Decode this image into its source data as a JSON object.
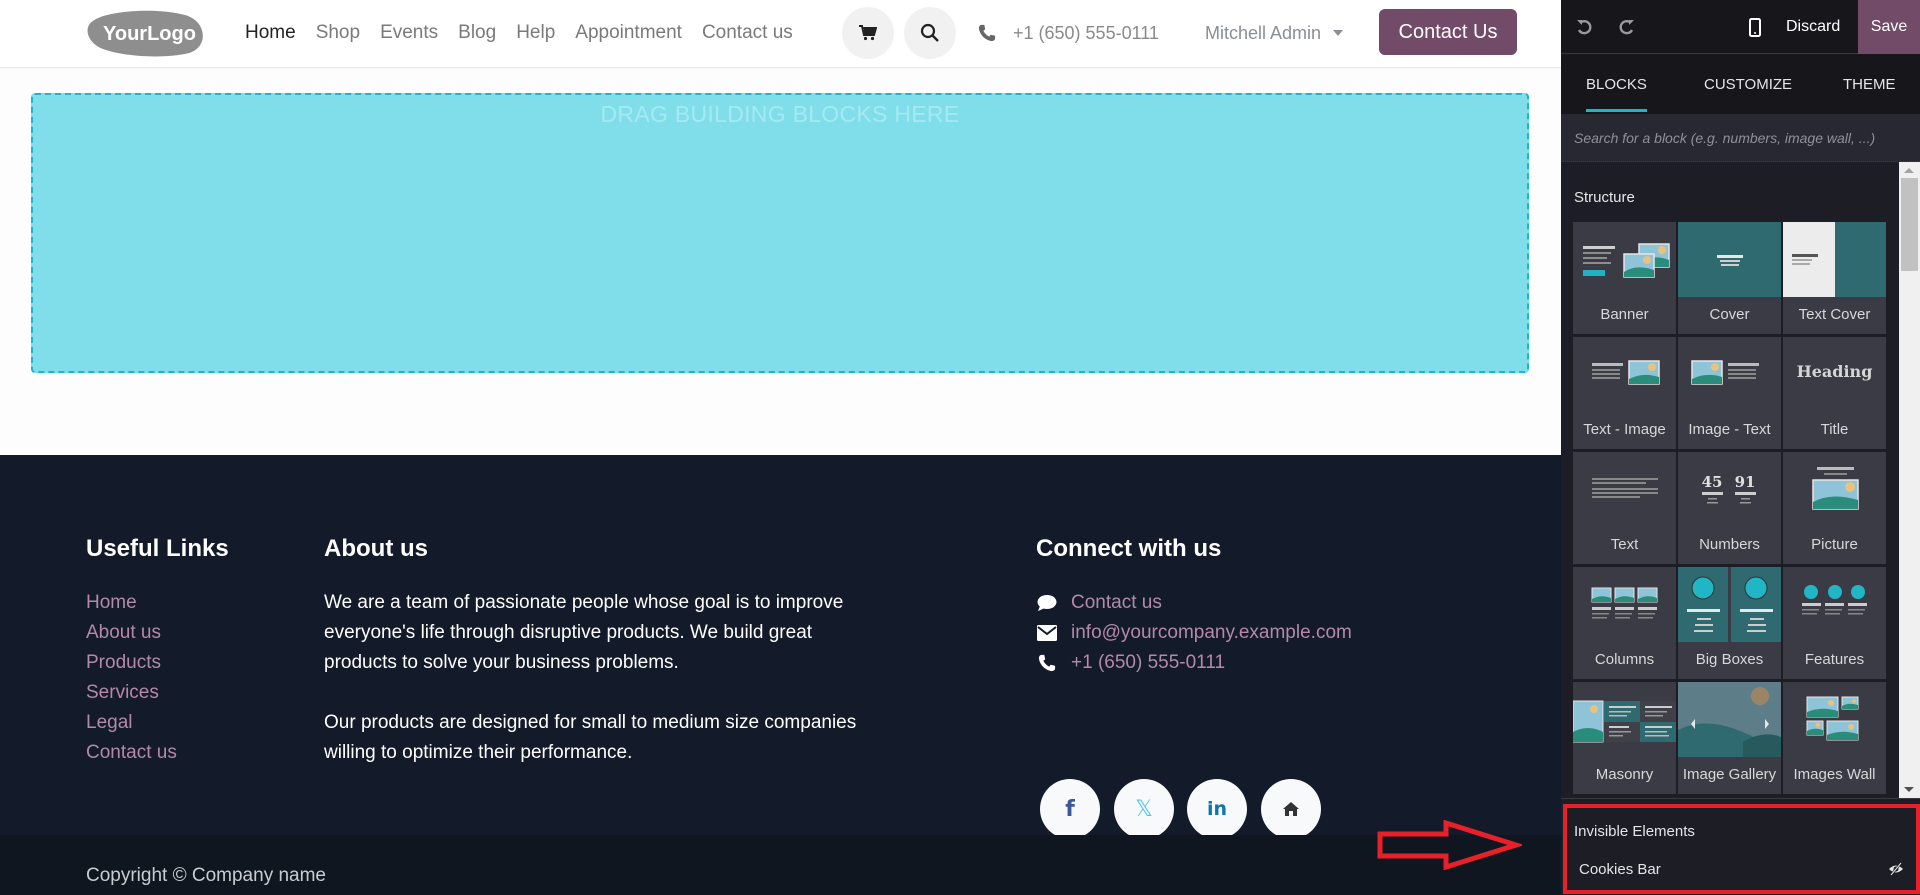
{
  "header": {
    "logo_text": "YourLogo",
    "nav": [
      {
        "label": "Home",
        "active": true
      },
      {
        "label": "Shop",
        "active": false
      },
      {
        "label": "Events",
        "active": false
      },
      {
        "label": "Blog",
        "active": false
      },
      {
        "label": "Help",
        "active": false
      },
      {
        "label": "Appointment",
        "active": false
      },
      {
        "label": "Contact us",
        "active": false
      }
    ],
    "cart_icon": "shopping-cart-icon",
    "search_icon": "search-icon",
    "phone": "+1 (650) 555-0111",
    "user_name": "Mitchell Admin",
    "cta_label": "Contact Us"
  },
  "dropzone": {
    "label": "DRAG BUILDING BLOCKS HERE"
  },
  "footer": {
    "useful_links": {
      "title": "Useful Links",
      "items": [
        "Home",
        "About us",
        "Products",
        "Services",
        "Legal",
        "Contact us"
      ]
    },
    "about": {
      "title": "About us",
      "paragraph1": "We are a team of passionate people whose goal is to improve everyone's life through disruptive products. We build great products to solve your business problems.",
      "paragraph2": "Our products are designed for small to medium size companies willing to optimize their performance."
    },
    "connect": {
      "title": "Connect with us",
      "contact_label": "Contact us",
      "email": "info@yourcompany.example.com",
      "phone": "+1 (650) 555-0111",
      "socials": [
        "facebook",
        "x-twitter",
        "linkedin",
        "home"
      ]
    },
    "copyright": "Copyright © Company name"
  },
  "panel": {
    "undo_icon": "undo-icon",
    "redo_icon": "redo-icon",
    "mobile_icon": "mobile-preview-icon",
    "discard_label": "Discard",
    "save_label": "Save",
    "tabs": [
      {
        "label": "BLOCKS",
        "active": true
      },
      {
        "label": "CUSTOMIZE",
        "active": false
      },
      {
        "label": "THEME",
        "active": false
      }
    ],
    "search_placeholder": "Search for a block (e.g. numbers, image wall, ...)",
    "category": "Structure",
    "blocks": [
      {
        "label": "Banner"
      },
      {
        "label": "Cover"
      },
      {
        "label": "Text Cover"
      },
      {
        "label": "Text - Image"
      },
      {
        "label": "Image - Text"
      },
      {
        "label": "Title"
      },
      {
        "label": "Text"
      },
      {
        "label": "Numbers"
      },
      {
        "label": "Picture"
      },
      {
        "label": "Columns"
      },
      {
        "label": "Big Boxes"
      },
      {
        "label": "Features"
      },
      {
        "label": "Masonry"
      },
      {
        "label": "Image Gallery"
      },
      {
        "label": "Images Wall"
      }
    ],
    "title_thumb_text": "Heading",
    "numbers_thumb": [
      "45",
      "91"
    ],
    "invisible": {
      "title": "Invisible Elements",
      "items": [
        {
          "label": "Cookies Bar",
          "icon": "eye-slash-icon"
        }
      ]
    }
  },
  "colors": {
    "brand": "#714b67",
    "accent": "#17b7d1",
    "footer_bg": "#131a2a",
    "link": "#b38aa8",
    "annotation": "#e8202a"
  }
}
